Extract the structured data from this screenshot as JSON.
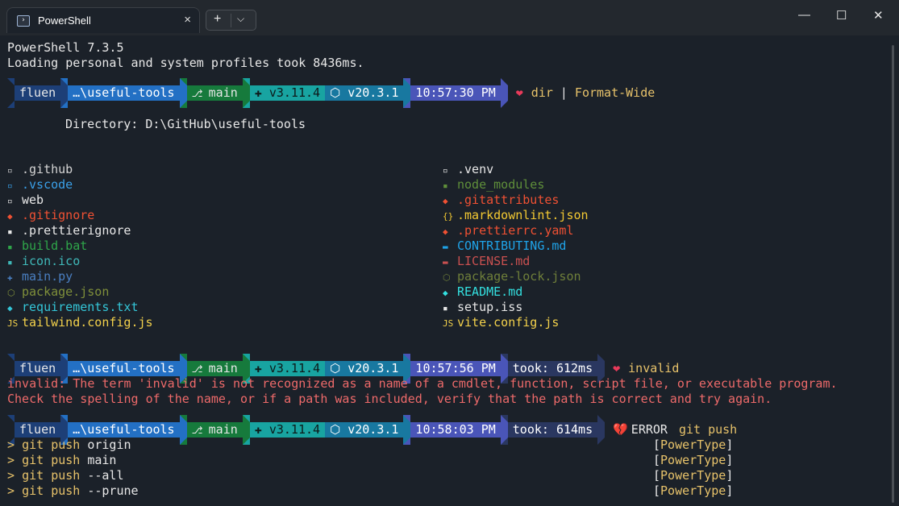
{
  "window": {
    "tab_title": "PowerShell",
    "tab_close": "×",
    "new_tab": "+",
    "dropdown": "⌵",
    "minimize": "—",
    "maximize": "☐",
    "close": "✕"
  },
  "header": {
    "line1": "PowerShell 7.3.5",
    "line2": "Loading personal and system profiles took 8436ms."
  },
  "prompt1": {
    "user": "fluen",
    "path": "…\\useful-tools",
    "branch": "main",
    "python": "v3.11.4",
    "node": "v20.3.1",
    "time": "10:57:30 PM",
    "heart": "❤",
    "cmd": "dir",
    "pipe": "|",
    "cmd2": "Format-Wide"
  },
  "directory": "Directory: D:\\GitHub\\useful-tools",
  "files_left": [
    {
      "icon": "▫",
      "name": ".github",
      "color": "#d4d4d4"
    },
    {
      "icon": "▫",
      "name": ".vscode",
      "color": "#3aa0e8"
    },
    {
      "icon": "▫",
      "name": "web",
      "color": "#e8e8e8"
    },
    {
      "icon": "◆",
      "name": ".gitignore",
      "color": "#f05133"
    },
    {
      "icon": "▪",
      "name": ".prettierignore",
      "color": "#e8e8e8"
    },
    {
      "icon": "▪",
      "name": "build.bat",
      "color": "#2fa64a"
    },
    {
      "icon": "▪",
      "name": "icon.ico",
      "color": "#3fb8b8"
    },
    {
      "icon": "✚",
      "name": "main.py",
      "color": "#4a7fc1"
    },
    {
      "icon": "⬡",
      "name": "package.json",
      "color": "#7f8f3a"
    },
    {
      "icon": "◆",
      "name": "requirements.txt",
      "color": "#34c6d8"
    },
    {
      "icon": "JS",
      "name": "tailwind.config.js",
      "color": "#f3d14b"
    }
  ],
  "files_right": [
    {
      "icon": "▫",
      "name": ".venv",
      "color": "#e8e8e8"
    },
    {
      "icon": "▪",
      "name": "node_modules",
      "color": "#5f8f3a"
    },
    {
      "icon": "◆",
      "name": ".gitattributes",
      "color": "#f05133"
    },
    {
      "icon": "{}",
      "name": ".markdownlint.json",
      "color": "#f3c932"
    },
    {
      "icon": "◆",
      "name": ".prettierrc.yaml",
      "color": "#f05133"
    },
    {
      "icon": "▬",
      "name": "CONTRIBUTING.md",
      "color": "#1fa3e8"
    },
    {
      "icon": "▬",
      "name": "LICENSE.md",
      "color": "#c95050"
    },
    {
      "icon": "⬡",
      "name": "package-lock.json",
      "color": "#6f7f3a"
    },
    {
      "icon": "◆",
      "name": "README.md",
      "color": "#33e0e0"
    },
    {
      "icon": "▪",
      "name": "setup.iss",
      "color": "#e8e8e8"
    },
    {
      "icon": "JS",
      "name": "vite.config.js",
      "color": "#f3d14b"
    }
  ],
  "prompt2": {
    "user": "fluen",
    "path": "…\\useful-tools",
    "branch": "main",
    "python": "v3.11.4",
    "node": "v20.3.1",
    "time": "10:57:56 PM",
    "took": "took: 612ms",
    "heart": "❤",
    "cmd": "invalid"
  },
  "error": {
    "line1": "invalid: The term 'invalid' is not recognized as a name of a cmdlet, function, script file, or executable program.",
    "line2": "Check the spelling of the name, or if a path was included, verify that the path is correct and try again."
  },
  "prompt3": {
    "user": "fluen",
    "path": "…\\useful-tools",
    "branch": "main",
    "python": "v3.11.4",
    "node": "v20.3.1",
    "time": "10:58:03 PM",
    "took": "took: 614ms",
    "heart": "💔",
    "status": "ERROR",
    "cmd": "git push"
  },
  "suggestions": [
    {
      "cmd": "git",
      "arg": "push",
      "rest": "origin",
      "type": "PowerType"
    },
    {
      "cmd": "git",
      "arg": "push",
      "rest": "main",
      "type": "PowerType"
    },
    {
      "cmd": "git",
      "arg": "push",
      "rest": "--all",
      "type": "PowerType"
    },
    {
      "cmd": "git",
      "arg": "push",
      "rest": "--prune",
      "type": "PowerType"
    }
  ],
  "colors": {
    "seg_user": "#1d3f77",
    "seg_path": "#2370c4",
    "seg_git": "#167a3c",
    "seg_py": "#18a4a1",
    "seg_node": "#1878a0",
    "seg_time": "#4a55b8",
    "seg_took": "#2a3760",
    "seg_error": "#1b2129"
  }
}
